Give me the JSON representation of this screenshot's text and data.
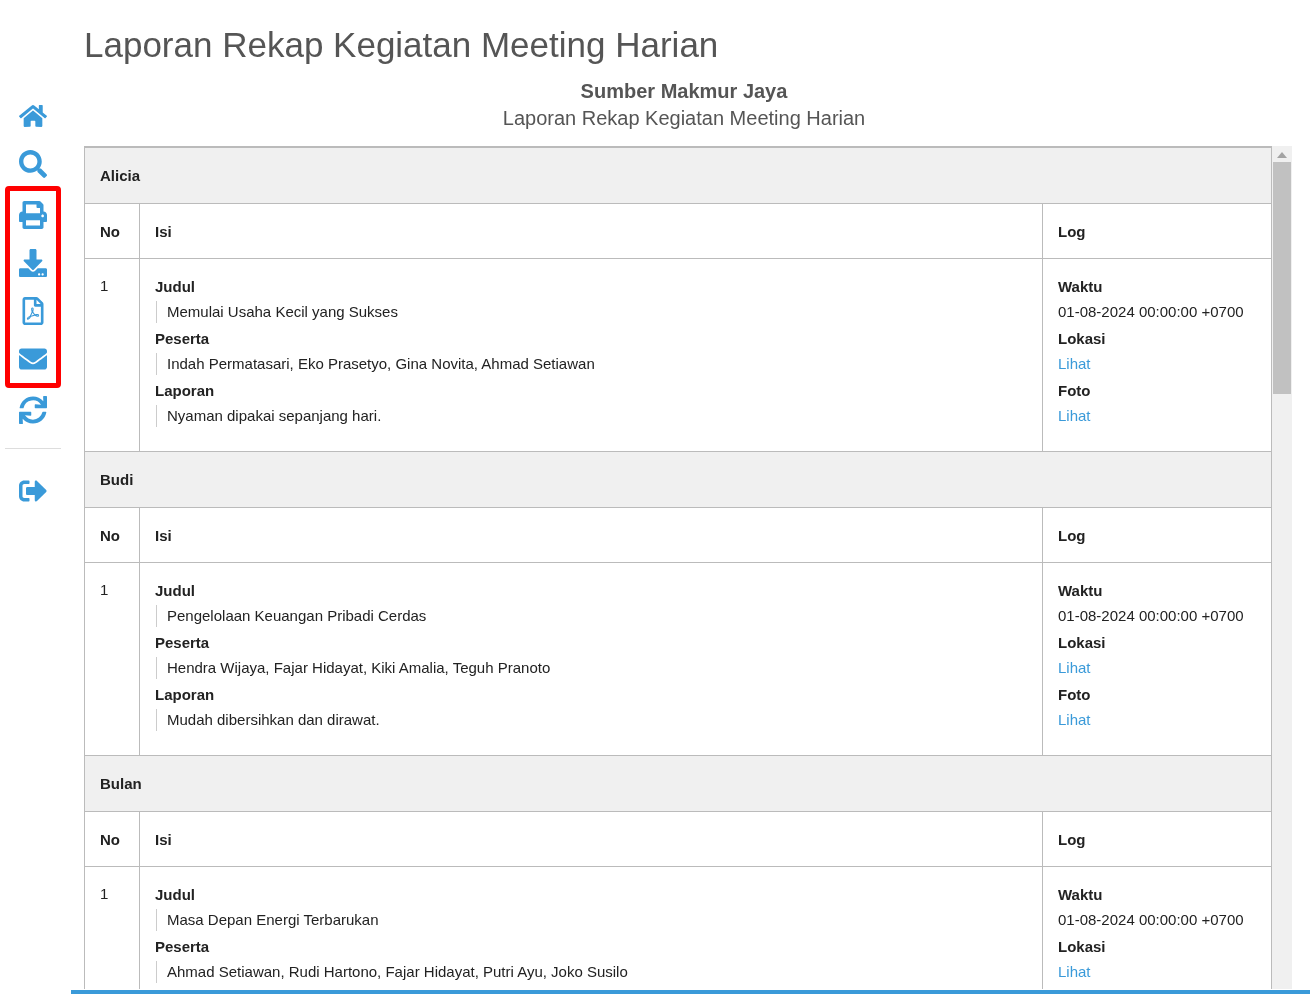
{
  "page": {
    "title": "Laporan Rekap Kegiatan Meeting Harian"
  },
  "sidebar": {
    "items": [
      {
        "kind": "home",
        "highlighted": false
      },
      {
        "kind": "search",
        "highlighted": false
      },
      {
        "kind": "print",
        "highlighted": true
      },
      {
        "kind": "download",
        "highlighted": true
      },
      {
        "kind": "pdf",
        "highlighted": true
      },
      {
        "kind": "email",
        "highlighted": true
      },
      {
        "kind": "refresh",
        "highlighted": false
      }
    ],
    "bottom_items": [
      {
        "kind": "logout",
        "highlighted": false
      }
    ]
  },
  "report": {
    "company": "Sumber Makmur Jaya",
    "title": "Laporan Rekap Kegiatan Meeting Harian",
    "groups": [
      {
        "name": "Alicia",
        "columns": [
          "No",
          "Isi",
          "Log"
        ],
        "rows": [
          {
            "no": "1",
            "fields": [
              {
                "label": "Judul",
                "value": "Memulai Usaha Kecil yang Sukses"
              },
              {
                "label": "Peserta",
                "value": "Indah Permatasari, Eko Prasetyo, Gina Novita, Ahmad Setiawan"
              },
              {
                "label": "Laporan",
                "value": "Nyaman dipakai sepanjang hari."
              }
            ],
            "log": [
              {
                "label": "Waktu",
                "value": "01-08-2024 00:00:00 +0700",
                "kind": "text"
              },
              {
                "label": "Lokasi",
                "value": "Lihat",
                "kind": "link"
              },
              {
                "label": "Foto",
                "value": "Lihat",
                "kind": "link"
              }
            ]
          }
        ]
      },
      {
        "name": "Budi",
        "columns": [
          "No",
          "Isi",
          "Log"
        ],
        "rows": [
          {
            "no": "1",
            "fields": [
              {
                "label": "Judul",
                "value": "Pengelolaan Keuangan Pribadi Cerdas"
              },
              {
                "label": "Peserta",
                "value": "Hendra Wijaya, Fajar Hidayat, Kiki Amalia, Teguh Pranoto"
              },
              {
                "label": "Laporan",
                "value": "Mudah dibersihkan dan dirawat."
              }
            ],
            "log": [
              {
                "label": "Waktu",
                "value": "01-08-2024 00:00:00 +0700",
                "kind": "text"
              },
              {
                "label": "Lokasi",
                "value": "Lihat",
                "kind": "link"
              },
              {
                "label": "Foto",
                "value": "Lihat",
                "kind": "link"
              }
            ]
          }
        ]
      },
      {
        "name": "Bulan",
        "columns": [
          "No",
          "Isi",
          "Log"
        ],
        "rows": [
          {
            "no": "1",
            "fields": [
              {
                "label": "Judul",
                "value": "Masa Depan Energi Terbarukan"
              },
              {
                "label": "Peserta",
                "value": "Ahmad Setiawan, Rudi Hartono, Fajar Hidayat, Putri Ayu, Joko Susilo"
              }
            ],
            "log": [
              {
                "label": "Waktu",
                "value": "01-08-2024 00:00:00 +0700",
                "kind": "text"
              },
              {
                "label": "Lokasi",
                "value": "Lihat",
                "kind": "link"
              }
            ]
          }
        ]
      }
    ]
  }
}
